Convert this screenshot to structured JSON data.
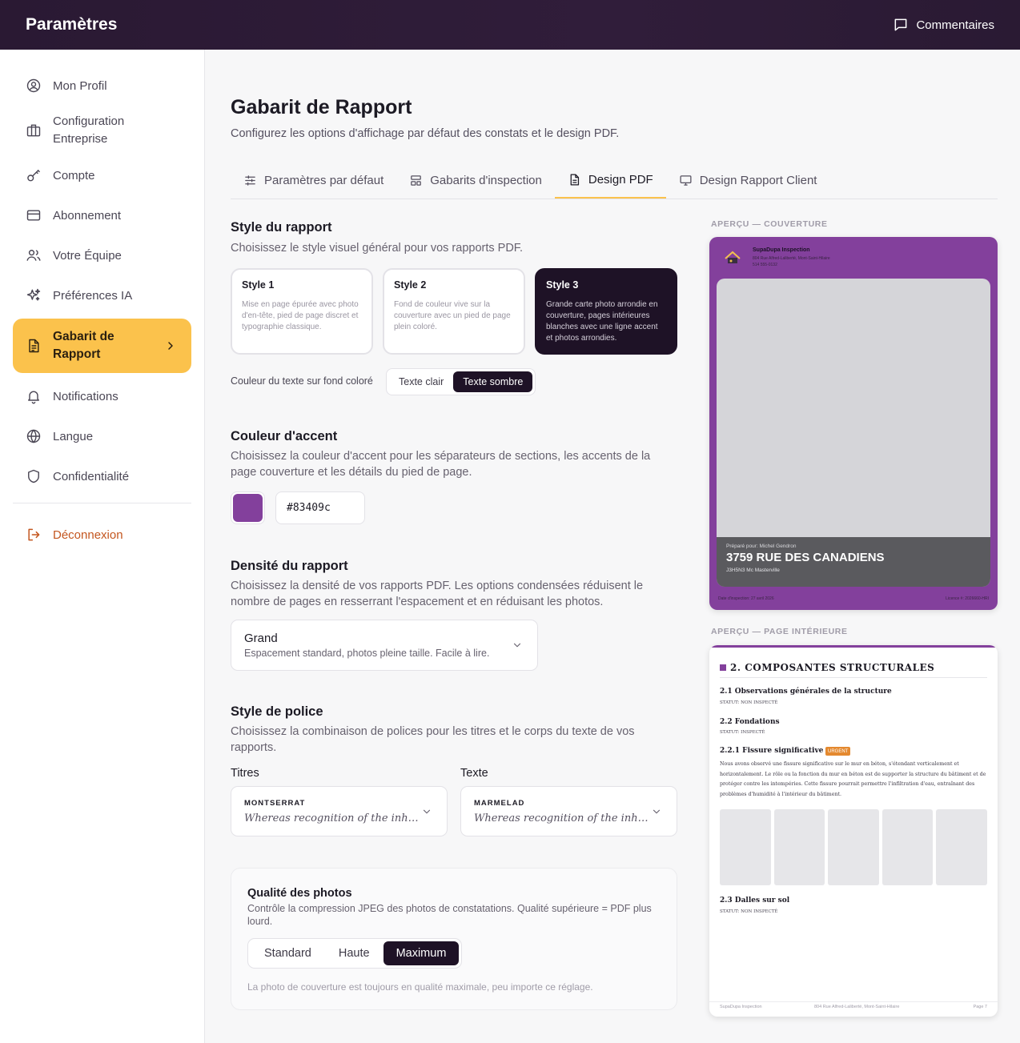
{
  "header": {
    "title": "Paramètres",
    "feedback_label": "Commentaires"
  },
  "sidebar": {
    "items": [
      {
        "label": "Mon Profil",
        "icon": "user-circle-icon"
      },
      {
        "label": "Configuration Entreprise",
        "icon": "briefcase-icon"
      },
      {
        "label": "Compte",
        "icon": "key-icon"
      },
      {
        "label": "Abonnement",
        "icon": "credit-card-icon"
      },
      {
        "label": "Votre Équipe",
        "icon": "users-icon"
      },
      {
        "label": "Préférences IA",
        "icon": "sparkles-icon"
      },
      {
        "label": "Gabarit de Rapport",
        "icon": "document-icon",
        "active": true
      },
      {
        "label": "Notifications",
        "icon": "bell-icon"
      },
      {
        "label": "Langue",
        "icon": "globe-icon"
      },
      {
        "label": "Confidentialité",
        "icon": "shield-icon"
      }
    ],
    "logout_label": "Déconnexion"
  },
  "page": {
    "title": "Gabarit de Rapport",
    "subtitle": "Configurez les options d'affichage par défaut des constats et le design PDF."
  },
  "tabs": [
    {
      "label": "Paramètres par défaut",
      "icon": "sliders-icon"
    },
    {
      "label": "Gabarits d'inspection",
      "icon": "layout-icon"
    },
    {
      "label": "Design PDF",
      "icon": "file-icon",
      "active": true
    },
    {
      "label": "Design Rapport Client",
      "icon": "monitor-icon"
    }
  ],
  "report_style": {
    "title": "Style du rapport",
    "description": "Choisissez le style visuel général pour vos rapports PDF.",
    "options": [
      {
        "name": "Style 1",
        "description": "Mise en page épurée avec photo d'en-tête, pied de page discret et typographie classique."
      },
      {
        "name": "Style 2",
        "description": "Fond de couleur vive sur la couverture avec un pied de page plein coloré."
      },
      {
        "name": "Style 3",
        "description": "Grande carte photo arrondie en couverture, pages intérieures blanches avec une ligne accent et photos arrondies.",
        "selected": true
      }
    ],
    "text_color_label": "Couleur du texte sur fond coloré",
    "text_color_options": [
      "Texte clair",
      "Texte sombre"
    ],
    "text_color_selected": "Texte sombre"
  },
  "accent": {
    "title": "Couleur d'accent",
    "description": "Choisissez la couleur d'accent pour les séparateurs de sections, les accents de la page couverture et les détails du pied de page.",
    "value": "#83409c"
  },
  "density": {
    "title": "Densité du rapport",
    "description": "Choisissez la densité de vos rapports PDF. Les options condensées réduisent le nombre de pages en resserrant l'espacement et en réduisant les photos.",
    "selected_label": "Grand",
    "selected_description": "Espacement standard, photos pleine taille. Facile à lire."
  },
  "font": {
    "title": "Style de police",
    "description": "Choisissez la combinaison de polices pour les titres et le corps du texte de vos rapports.",
    "titles_label": "Titres",
    "titles_font": "MONTSERRAT",
    "titles_sample": "Whereas recognition of the inh…",
    "body_label": "Texte",
    "body_font": "MARMELAD",
    "body_sample": "Whereas recognition of the inh…"
  },
  "photo_quality": {
    "title": "Qualité des photos",
    "description": "Contrôle la compression JPEG des photos de constatations. Qualité supérieure = PDF plus lourd.",
    "options": [
      "Standard",
      "Haute",
      "Maximum"
    ],
    "selected": "Maximum",
    "note": "La photo de couverture est toujours en qualité maximale, peu importe ce réglage."
  },
  "preview": {
    "cover_label": "APERÇU — COUVERTURE",
    "company": "SupaDupa Inspection",
    "company_address": "804 Rue Alfred-Laliberté, Mont-Saint-Hilaire",
    "company_phone": "514 555-0132",
    "prepared_for": "Préparé pour: Michel Gendron",
    "address": "3759 RUE DES CANADIENS",
    "city": "J3H5N3 Mc Masterville",
    "footer_left": "Date d'inspection: 27 avril 2026",
    "footer_right": "Licence #: 2026660-HRI",
    "inner_label": "APERÇU — PAGE INTÉRIEURE",
    "section_title": "2. COMPOSANTES STRUCTURALES",
    "items": [
      {
        "title": "2.1 Observations générales de la structure",
        "status": "STATUT: NON INSPECTÉ"
      },
      {
        "title": "2.2 Fondations",
        "status": "STATUT: INSPECTÉ"
      }
    ],
    "finding_title": "2.2.1 Fissure significative",
    "finding_badge": "URGENT",
    "finding_text": "Nous avons observé une fissure significative sur le mur en béton, s'étendant verticalement et horizontalement. Le rôle ou la fonction du mur en béton est de supporter la structure du bâtiment et de protéger contre les intempéries. Cette fissure pourrait permettre l'infiltration d'eau, entraînant des problèmes d'humidité à l'intérieur du bâtiment.",
    "last_item": {
      "title": "2.3 Dalles sur sol",
      "status": "STATUT: NON INSPECTÉ"
    },
    "inner_footer_left": "SupaDupa Inspection",
    "inner_footer_center": "804 Rue Alfred-Laliberté, Mont-Saint-Hilaire",
    "inner_footer_right": "Page 7"
  },
  "colors": {
    "accent": "#83409c",
    "sidebar_active": "#fbc24c",
    "dark": "#1e1226",
    "urgent": "#e4892f",
    "logout": "#c4561f"
  }
}
